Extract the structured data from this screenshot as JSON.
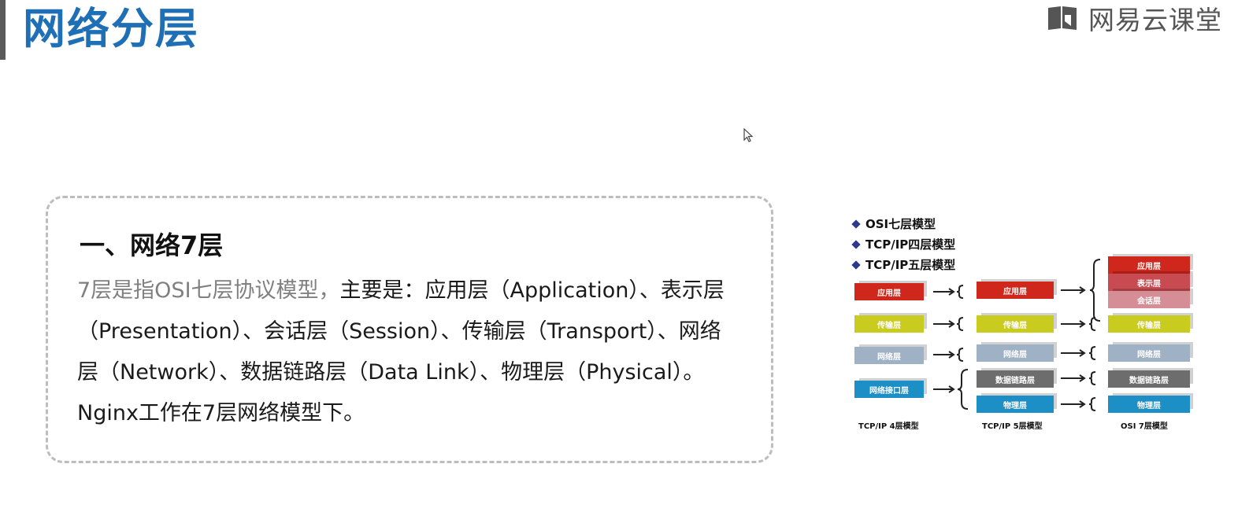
{
  "header": {
    "title": "网络分层",
    "brand": "网易云课堂"
  },
  "card": {
    "heading": "一、网络7层",
    "lead": "7层是指OSI七层协议模型，",
    "body": "主要是：应用层（Application）、表示层（Presentation）、会话层（Session）、传输层（Transport）、网络层（Network）、数据链路层（Data Link）、物理层（Physical）。Nginx工作在7层网络模型下。"
  },
  "diagram": {
    "legend": [
      "OSI七层模型",
      "TCP/IP四层模型",
      "TCP/IP五层模型"
    ],
    "tcpip4": [
      "应用层",
      "传输层",
      "网络层",
      "网络接口层"
    ],
    "tcpip5": [
      "应用层",
      "传输层",
      "网络层",
      "数据链路层",
      "物理层"
    ],
    "osi7": [
      "应用层",
      "表示层",
      "会话层",
      "传输层",
      "网络层",
      "数据链路层",
      "物理层"
    ],
    "captions": [
      "TCP/IP 4层模型",
      "TCP/IP 5层模型",
      "OSI 7层模型"
    ],
    "colors": {
      "application": "#d0271d",
      "presentation": "#c94b52",
      "session": "#d58e96",
      "transport": "#c9cc1e",
      "network": "#9fb1c5",
      "datalink": "#6d6d6d",
      "physical": "#1c8fc6"
    }
  }
}
